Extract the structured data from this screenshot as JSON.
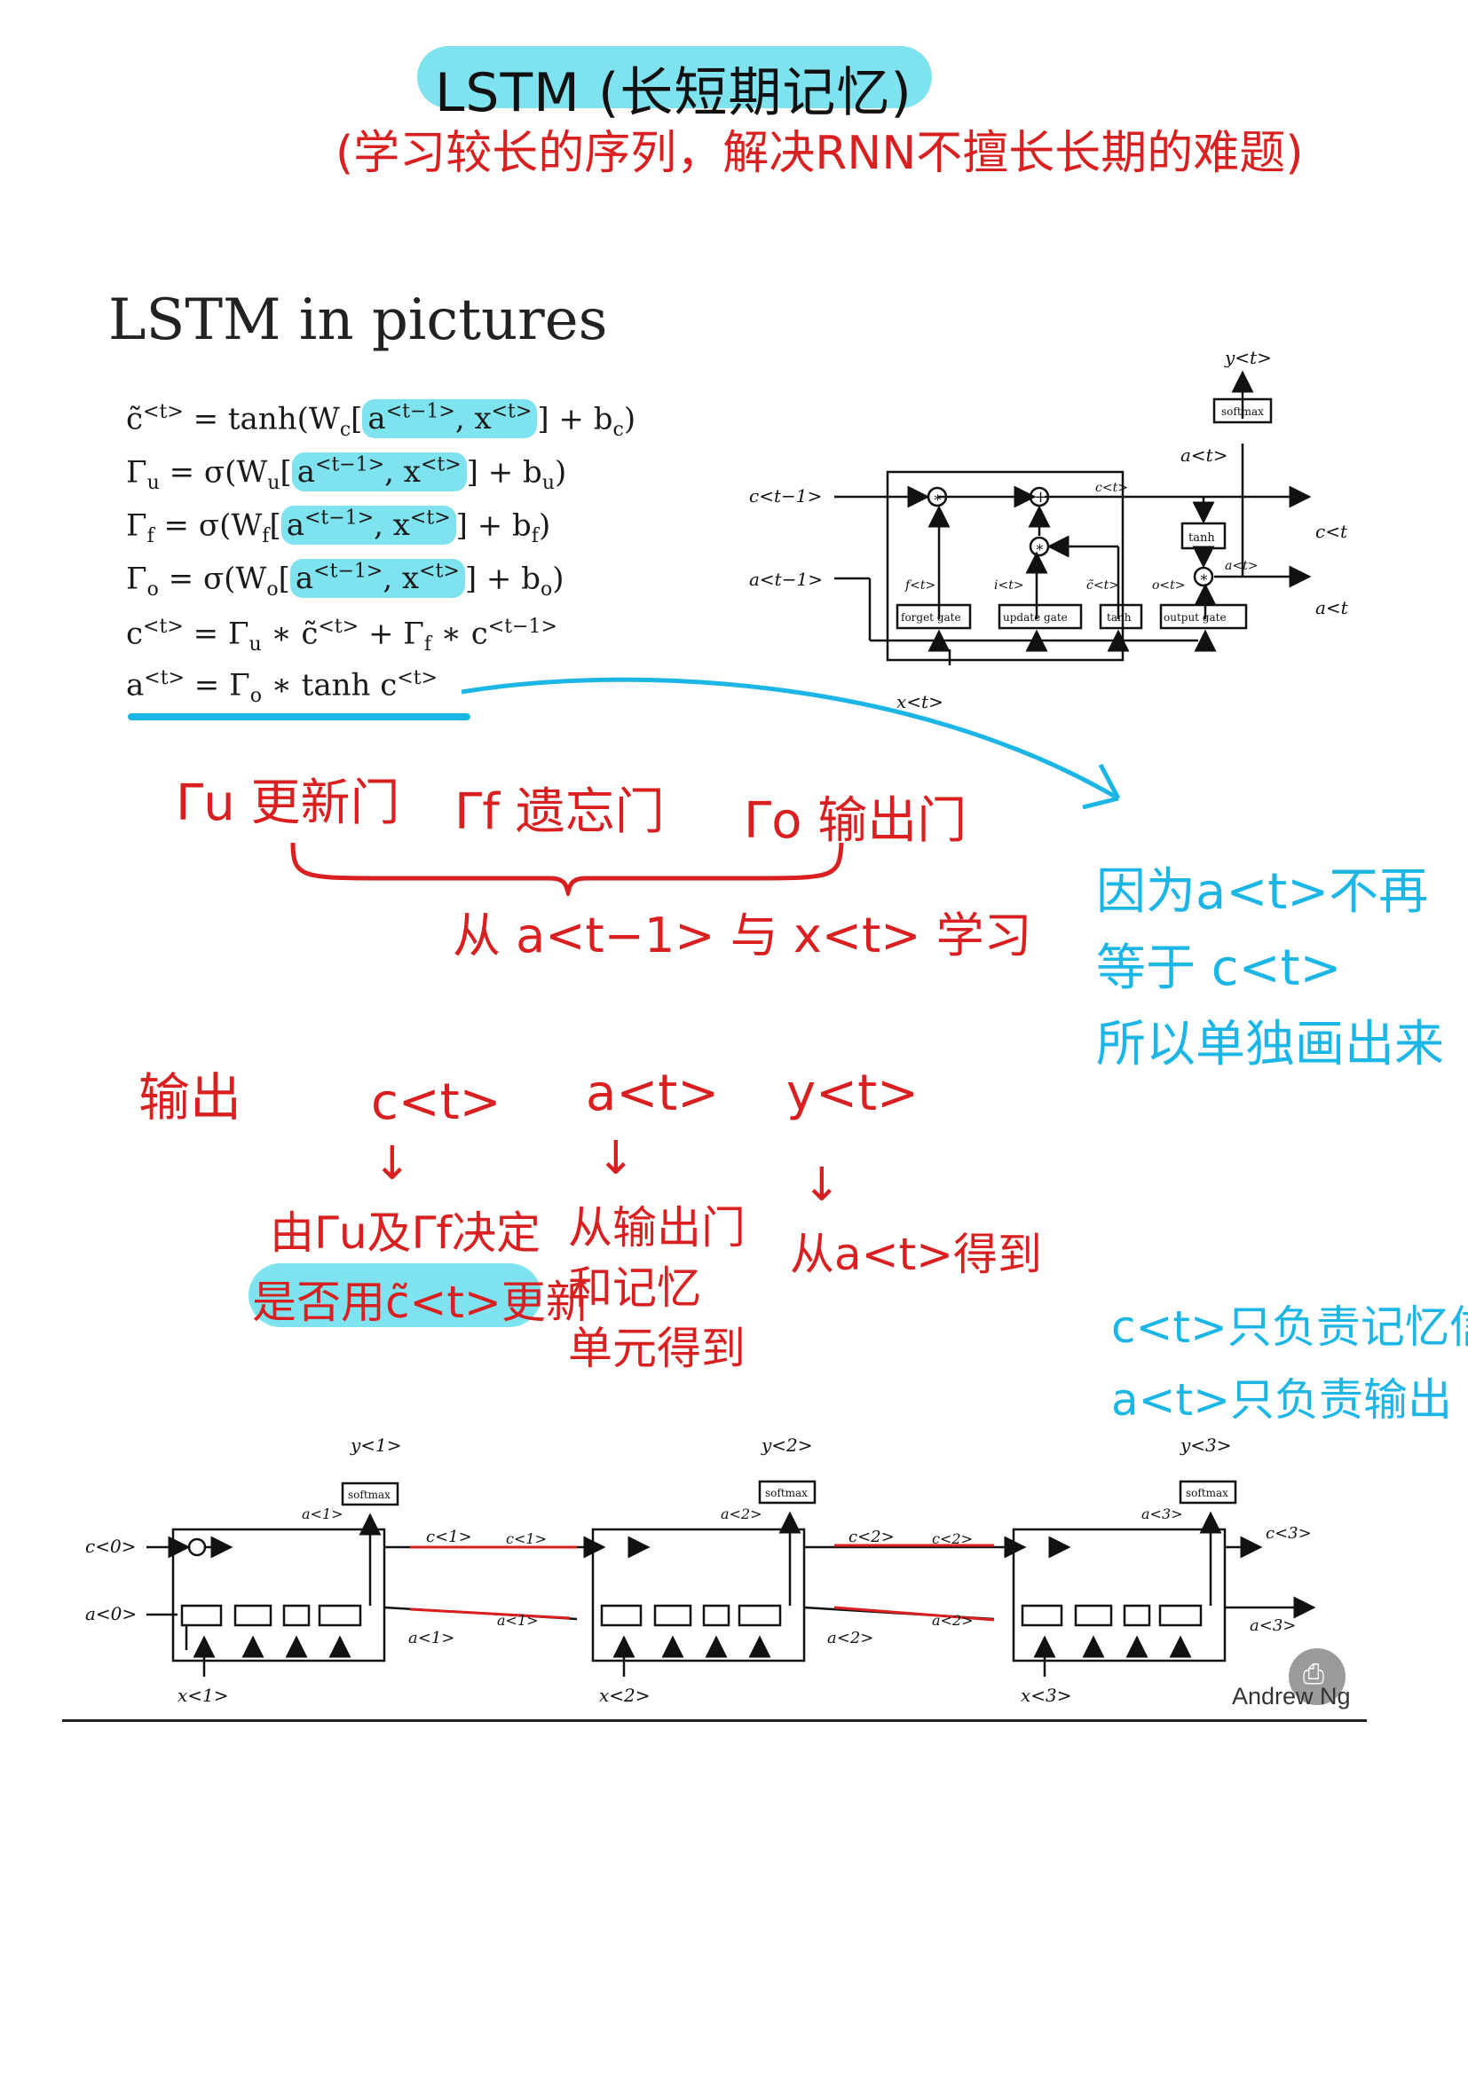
{
  "header": {
    "title": "LSTM (长短期记忆)",
    "subtitle": "(学习较长的序列，解决RNN不擅长长期的难题)"
  },
  "slide": {
    "heading": "LSTM in pictures",
    "equations": {
      "c_tilde": {
        "lhs": "c̃",
        "lhs_sup": "<t>",
        "pre": " = tanh(W",
        "w_sub": "c",
        "hl_a": "a",
        "hl_a_sup": "<t−1>",
        "hl_x": ", x",
        "hl_x_sup": "<t>",
        "post": "] + b",
        "b_sub": "c",
        "end": ")"
      },
      "gamma_u": {
        "lhs": "Γ",
        "lhs_sub": "u",
        "pre": " = σ(W",
        "w_sub": "u",
        "hl_a": "a",
        "hl_a_sup": "<t−1>",
        "hl_x": ", x",
        "hl_x_sup": "<t>",
        "post": "] + b",
        "b_sub": "u",
        "end": ")"
      },
      "gamma_f": {
        "lhs": "Γ",
        "lhs_sub": "f",
        "pre": " = σ(W",
        "w_sub": "f",
        "hl_a": "a",
        "hl_a_sup": "<t−1>",
        "hl_x": ", x",
        "hl_x_sup": "<t>",
        "post": "] + b",
        "b_sub": "f",
        "end": ")"
      },
      "gamma_o": {
        "lhs": "Γ",
        "lhs_sub": "o",
        "pre": " = σ(W",
        "w_sub": "o",
        "hl_a": "a",
        "hl_a_sup": "<t−1>",
        "hl_x": ", x",
        "hl_x_sup": "<t>",
        "post": "] + b",
        "b_sub": "o",
        "end": ")"
      },
      "c_t": {
        "text_a": "c",
        "sup_a": "<t>",
        "text_b": " =  Γ",
        "sub_b": "u",
        "text_c": " ∗ c̃",
        "sup_c": "<t>",
        "text_d": " + Γ",
        "sub_d": "f",
        "text_e": " ∗ c",
        "sup_e": "<t−1>"
      },
      "a_t": {
        "text_a": "a",
        "sup_a": "<t>",
        "text_b": " = Γ",
        "sub_b": "o",
        "text_c": " ∗ tanh c",
        "sup_c": "<t>"
      }
    }
  },
  "cell_diagram": {
    "y_out": "y<t>",
    "softmax": "softmax",
    "a_top": "a<t>",
    "c_in": "c<t−1>",
    "a_in": "a<t−1>",
    "c_mid": "c<t>",
    "c_out": "c<t>",
    "a_out": "a<t>",
    "a_inner": "a<t>",
    "tanh_top": "tanh",
    "f_label": "f<t>",
    "i_label": "i<t>",
    "c_tilde_label": "c̃<t>",
    "o_label": "o<t>",
    "forget_gate": "forget gate",
    "update_gate": "update gate",
    "tanh_gate": "tanh",
    "output_gate": "output gate",
    "x_in": "x<t>",
    "mul": "∗",
    "add": "+"
  },
  "red_notes": {
    "gate_u": "Γu 更新门",
    "gate_f": "Γf 遗忘门",
    "gate_o": "Γo 输出门",
    "learn_from": "从 a<t−1> 与 x<t> 学习",
    "output_label": "输出",
    "c_head": "c<t>",
    "a_head": "a<t>",
    "y_head": "y<t>",
    "c_desc_1": "由Γu及Γf决定",
    "c_desc_2": "是否用c̃<t>更新",
    "a_desc_1": "从输出门",
    "a_desc_2": "和记忆",
    "a_desc_3": "单元得到",
    "y_desc": "从a<t>得到",
    "arrow": "↓"
  },
  "blue_notes": {
    "why_1": "因为a<t>不再",
    "why_2": "等于 c<t>",
    "why_3": "所以单独画出来",
    "role_c": "c<t>只负责记忆信息",
    "role_a": "a<t>只负责输出"
  },
  "chain": {
    "cells": [
      {
        "y": "y<1>",
        "a_top": "a<1>",
        "c_out": "c<1>",
        "a_out": "a<1>",
        "x": "x<1>",
        "softmax": "softmax"
      },
      {
        "y": "y<2>",
        "a_top": "a<2>",
        "c_out": "c<2>",
        "a_out": "a<2>",
        "x": "x<2>",
        "softmax": "softmax"
      },
      {
        "y": "y<3>",
        "a_top": "a<3>",
        "c_out": "c<3>",
        "a_out": "a<3>",
        "x": "x<3>",
        "softmax": "softmax"
      }
    ],
    "c0": "c<0>",
    "a0": "a<0>",
    "c_in_2": "c<1>",
    "a_in_2": "a<1>",
    "c_in_3": "c<2>",
    "a_in_3": "a<2>"
  },
  "footer": {
    "credit": "Andrew Ng",
    "scan_icon": "document-scan-icon",
    "scan_glyph": "⎙"
  },
  "colors": {
    "red_ink": "#d91f1f",
    "blue_ink": "#1cb6e6",
    "highlight": "#7ee3ef"
  }
}
